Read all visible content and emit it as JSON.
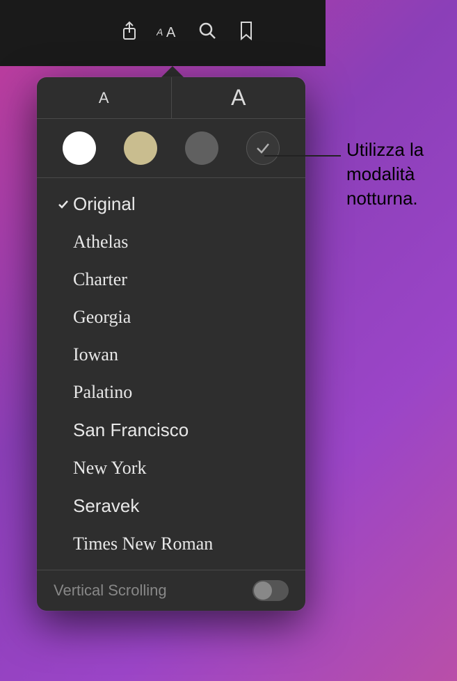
{
  "toolbar": {
    "icons": [
      "share-icon",
      "appearance-icon",
      "search-icon",
      "bookmark-icon"
    ]
  },
  "popover": {
    "font_size_small": "A",
    "font_size_large": "A",
    "themes": {
      "white": "#ffffff",
      "sepia": "#c9bd8f",
      "gray": "#606060",
      "night": "#383838",
      "selected": "night"
    },
    "fonts": [
      {
        "name": "Original",
        "selected": true,
        "css": "font-original"
      },
      {
        "name": "Athelas",
        "selected": false,
        "css": "font-athelas"
      },
      {
        "name": "Charter",
        "selected": false,
        "css": "font-charter"
      },
      {
        "name": "Georgia",
        "selected": false,
        "css": "font-georgia"
      },
      {
        "name": "Iowan",
        "selected": false,
        "css": "font-iowan"
      },
      {
        "name": "Palatino",
        "selected": false,
        "css": "font-palatino"
      },
      {
        "name": "San Francisco",
        "selected": false,
        "css": "font-sanfrancisco"
      },
      {
        "name": "New York",
        "selected": false,
        "css": "font-newyork"
      },
      {
        "name": "Seravek",
        "selected": false,
        "css": "font-seravek"
      },
      {
        "name": "Times New Roman",
        "selected": false,
        "css": "font-times"
      }
    ],
    "vertical_scrolling": {
      "label": "Vertical Scrolling",
      "enabled": false
    }
  },
  "callout": {
    "text": "Utilizza la modalità notturna."
  }
}
